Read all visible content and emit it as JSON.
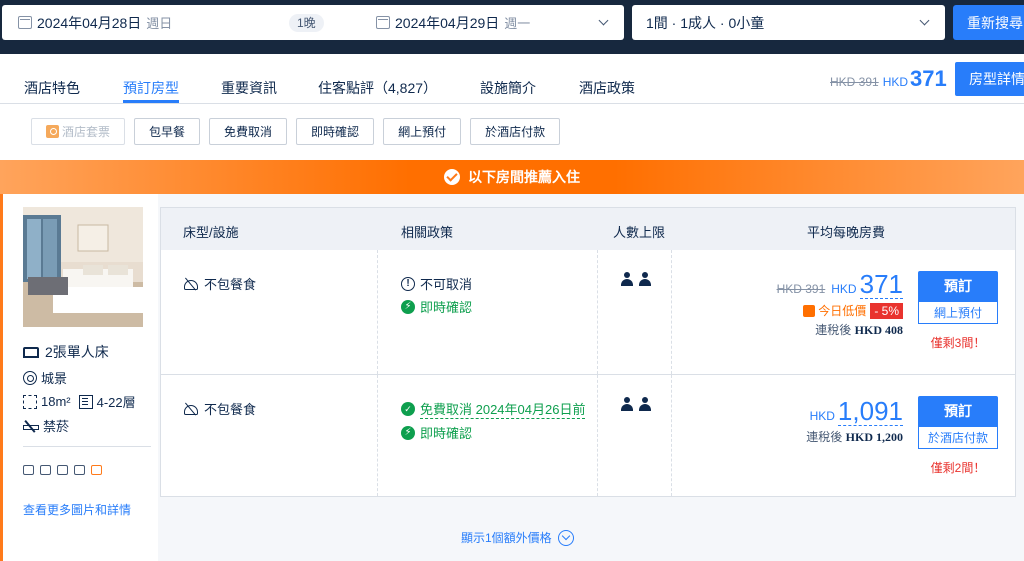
{
  "search": {
    "checkin_date": "2024年04月28日",
    "checkin_week": "週日",
    "nights": "1晚",
    "checkout_date": "2024年04月29日",
    "checkout_week": "週一",
    "guests": "1間 · 1成人 · 0小童",
    "search_button": "重新搜尋"
  },
  "tabs": {
    "items": [
      "酒店特色",
      "預訂房型",
      "重要資訊",
      "住客點評（4,827）",
      "設施簡介",
      "酒店政策"
    ],
    "active_index": 1,
    "price_old": "HKD 391",
    "price_currency": "HKD",
    "price_value": "371",
    "details_button": "房型詳情"
  },
  "filters": [
    "酒店套票",
    "包早餐",
    "免費取消",
    "即時確認",
    "網上預付",
    "於酒店付款"
  ],
  "banner": {
    "text": "以下房間推薦入住"
  },
  "room": {
    "bed": "2張單人床",
    "view": "城景",
    "size": "18m²",
    "floor": "4-22層",
    "smoking": "禁菸",
    "more_link": "查看更多圖片和詳情"
  },
  "table": {
    "headers": [
      "床型/設施",
      "相關政策",
      "人數上限",
      "平均每晚房費"
    ],
    "rows": [
      {
        "meal": "不包餐食",
        "policy1": "不可取消",
        "policy2": "即時確認",
        "price_old": "HKD 391",
        "currency": "HKD",
        "price": "371",
        "deal_label": "今日低價",
        "deal_pct": "- 5%",
        "tax_prefix": "連稅後",
        "tax_value": "HKD 408",
        "book": "預訂",
        "book_sub": "網上預付",
        "rooms_left": "僅剩3間！"
      },
      {
        "meal": "不包餐食",
        "policy1": "免費取消 2024年04月26日前",
        "policy2": "即時確認",
        "currency": "HKD",
        "price": "1,091",
        "tax_prefix": "連稅後",
        "tax_value": "HKD 1,200",
        "book": "預訂",
        "book_sub": "於酒店付款",
        "rooms_left": "僅剩2間！"
      }
    ],
    "more_prices": "顯示1個額外價格"
  },
  "colors": {
    "navy": "#17283e",
    "blue": "#287dfa",
    "orange": "#ff6f00",
    "red": "#e9332e",
    "green": "#0e9f4e"
  }
}
